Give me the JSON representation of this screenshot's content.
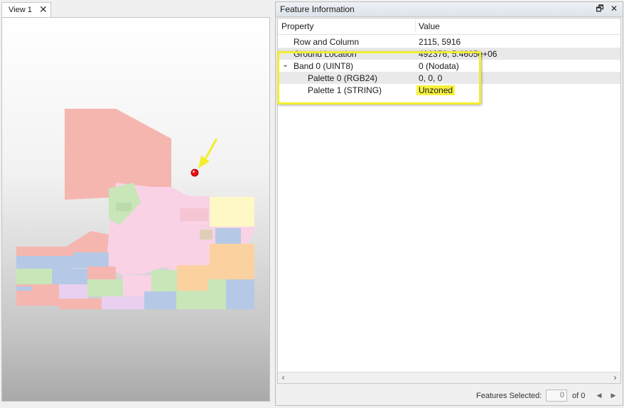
{
  "view_tab": {
    "label": "View 1",
    "close_glyph": "✕"
  },
  "panel": {
    "title": "Feature Information",
    "restore_glyph": "🗗",
    "close_glyph": "✕",
    "columns": {
      "property": "Property",
      "value": "Value"
    },
    "rows": [
      {
        "property": "Row and Column",
        "value": "2115, 5916"
      },
      {
        "property": "Ground Location",
        "value": "492376, 5.4605e+06"
      },
      {
        "property": "Band 0 (UINT8)",
        "value": "0 (Nodata)",
        "expander": "⌄"
      },
      {
        "property": "Palette 0 (RGB24)",
        "value": "0, 0, 0"
      },
      {
        "property": "Palette 1 (STRING)",
        "value": "Unzoned"
      }
    ],
    "scroll_left": "‹",
    "scroll_right": "›"
  },
  "status": {
    "features_selected_label": "Features Selected:",
    "features_selected_value": "0",
    "of_text": "of 0",
    "prev_glyph": "◀",
    "next_glyph": "▶"
  },
  "colors": {
    "highlight": "#f7f23f",
    "marker": "#e81010",
    "zone_pink": "#f6b6b0",
    "zone_lightpink": "#f9d2e6",
    "zone_green": "#c8e6b8",
    "zone_blue": "#b5c9e6",
    "zone_orange": "#fbd1a0",
    "zone_yellow": "#fdf8c5"
  }
}
